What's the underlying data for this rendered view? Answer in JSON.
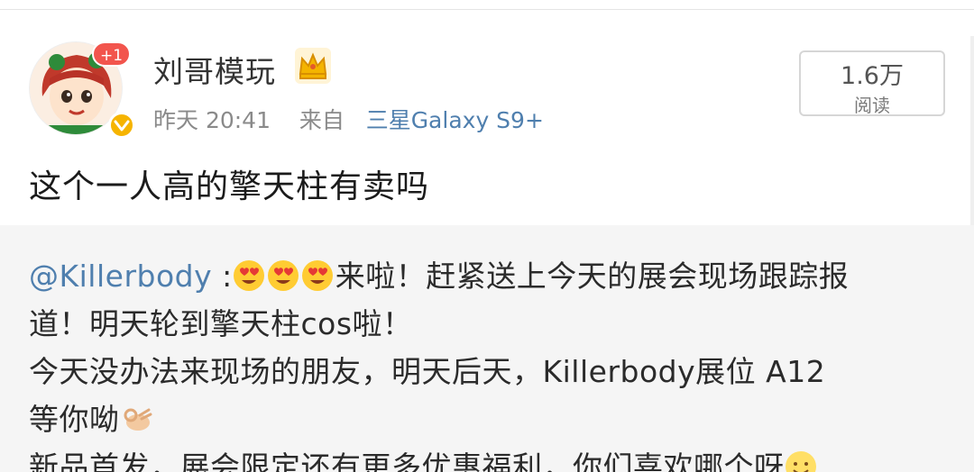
{
  "post": {
    "username": "刘哥模玩",
    "avatar_badge": "+1",
    "time": "昨天 20:41",
    "source_prefix": "来自",
    "device": "三星Galaxy S9+",
    "read_count": "1.6万",
    "read_label": "阅读",
    "text": "这个一人高的擎天柱有卖吗"
  },
  "repost": {
    "mention": "@Killerbody",
    "mention_sep": " :",
    "line1_tail": "来啦！赶紧送上今天的展会现场跟踪报",
    "line2": "道！明天轮到擎天柱cos啦！",
    "line3": "今天没办法来现场的朋友，明天后天，Killerbody展位 A12",
    "line4": "等你呦",
    "line5": "新品首发，展会限定还有更多优惠福利，你们喜欢哪个呀"
  },
  "icons": {
    "crown": "vip-crown-icon",
    "verified": "verified-badge-icon",
    "heart_eyes": "heart-eyes-emoji",
    "ok_hand": "ok-hand-emoji",
    "smile": "smile-emoji"
  },
  "colors": {
    "link": "#4f7fae",
    "badge_red": "#f2554d",
    "verified_yellow": "#f6b400",
    "repost_bg": "#f5f5f5"
  }
}
